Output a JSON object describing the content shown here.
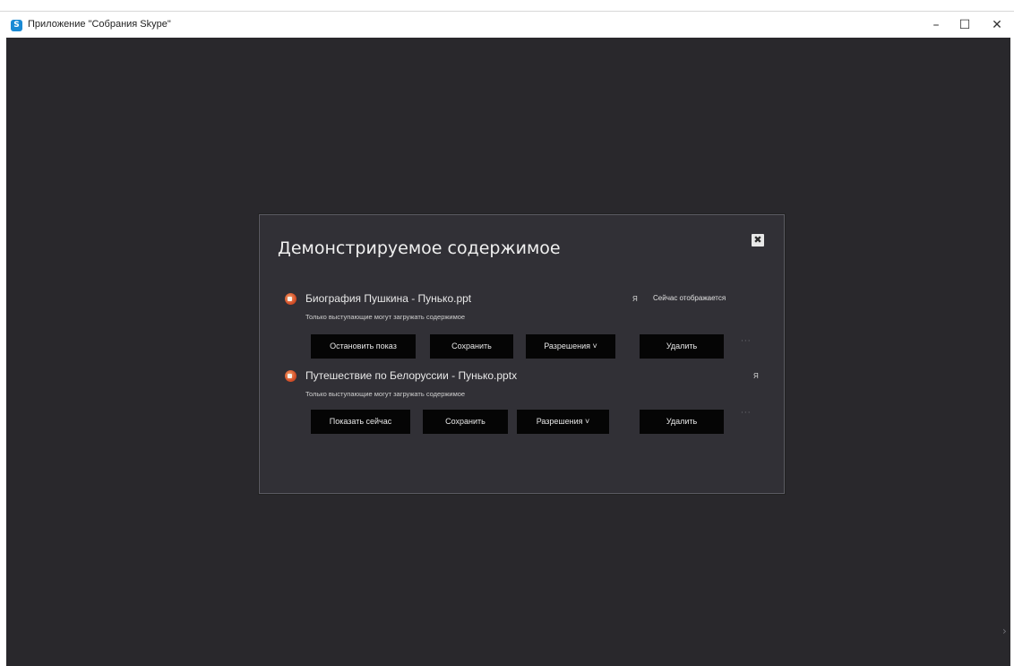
{
  "window": {
    "title": "Приложение \"Собрания Skype\"",
    "app_icon": "skype-icon",
    "minimize_glyph": "–",
    "maximize_glyph": "☐",
    "close_glyph": "✕"
  },
  "dialog": {
    "title": "Демонстрируемое содержимое",
    "close_icon": "close-icon",
    "close_glyph": "✖",
    "items": [
      {
        "icon": "powerpoint-icon",
        "name": "Биография Пушкина - Пунько.ppt",
        "subtitle": "Только выступающие могут загружать содержимое",
        "author": "Я",
        "status": "Сейчас отображается",
        "primary_button": "Остановить показ",
        "save_button": "Сохранить",
        "permissions_button": "Разрешения ˅",
        "delete_button": "Удалить",
        "more": "···"
      },
      {
        "icon": "powerpoint-icon",
        "name": "Путешествие по Белоруссии - Пунько.pptx",
        "subtitle": "Только выступающие могут загружать содержимое",
        "author": "Я",
        "status": "",
        "primary_button": "Показать сейчас",
        "save_button": "Сохранить",
        "permissions_button": "Разрешения ˅",
        "delete_button": "Удалить",
        "more": "···"
      }
    ]
  },
  "colors": {
    "background": "#29282c",
    "dialog": "#313036",
    "button": "#050505",
    "text": "#e8e8e8"
  }
}
